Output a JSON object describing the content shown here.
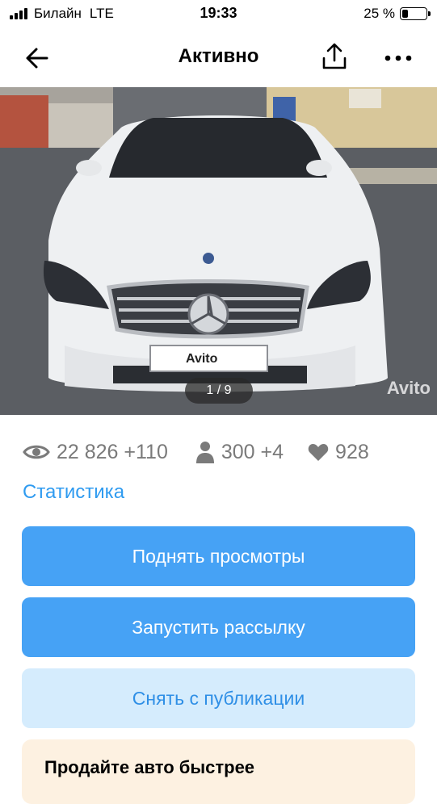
{
  "status_bar": {
    "carrier": "Билайн",
    "network": "LTE",
    "time": "19:33",
    "battery_text": "25 %",
    "battery_level": 0.25
  },
  "nav": {
    "title": "Активно",
    "back_icon": "arrow-left-icon",
    "share_icon": "share-icon",
    "more_icon": "more-icon"
  },
  "photo": {
    "counter": "1 / 9",
    "watermark": "Avito",
    "plate_text": "Avito"
  },
  "stats": {
    "views": "22 826 +110",
    "contacts": "300 +4",
    "favorites": "928"
  },
  "statistics_link": "Статистика",
  "buttons": {
    "raise_views": "Поднять просмотры",
    "start_mailing": "Запустить рассылку",
    "unpublish": "Снять с публикации"
  },
  "promo": {
    "title": "Продайте авто быстрее"
  },
  "colors": {
    "accent": "#46a2f5",
    "link": "#2f9bf0",
    "secondary_bg": "#d5ecfd",
    "promo_bg": "#fdf1e1"
  }
}
